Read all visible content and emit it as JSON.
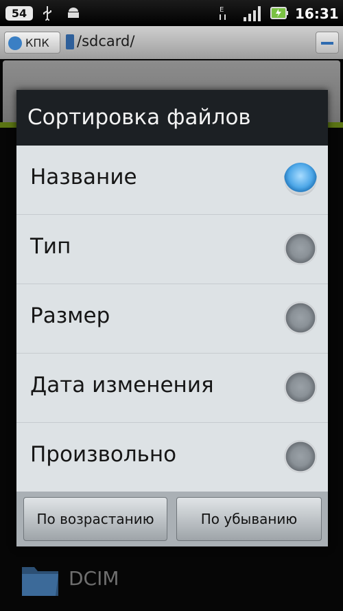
{
  "status_bar": {
    "badge": "54",
    "time": "16:31",
    "icons": [
      "usb-icon",
      "android-icon",
      "data-e-icon",
      "signal-icon",
      "battery-icon"
    ]
  },
  "path_bar": {
    "location_button": "КПК",
    "path": "/sdcard/"
  },
  "dialog": {
    "title": "Сортировка файлов",
    "options": [
      {
        "label": "Название",
        "checked": true
      },
      {
        "label": "Тип",
        "checked": false
      },
      {
        "label": "Размер",
        "checked": false
      },
      {
        "label": "Дата изменения",
        "checked": false
      },
      {
        "label": "Произвольно",
        "checked": false
      }
    ],
    "ascending_label": "По возрастанию",
    "descending_label": "По убыванию"
  },
  "file_list": [
    {
      "name": "DCIM",
      "icon": "folder-icon"
    }
  ],
  "colors": {
    "accent": "#4fa8e8",
    "toolbar_highlight": "#8ab21e",
    "dialog_title_bg": "#1c2024"
  }
}
